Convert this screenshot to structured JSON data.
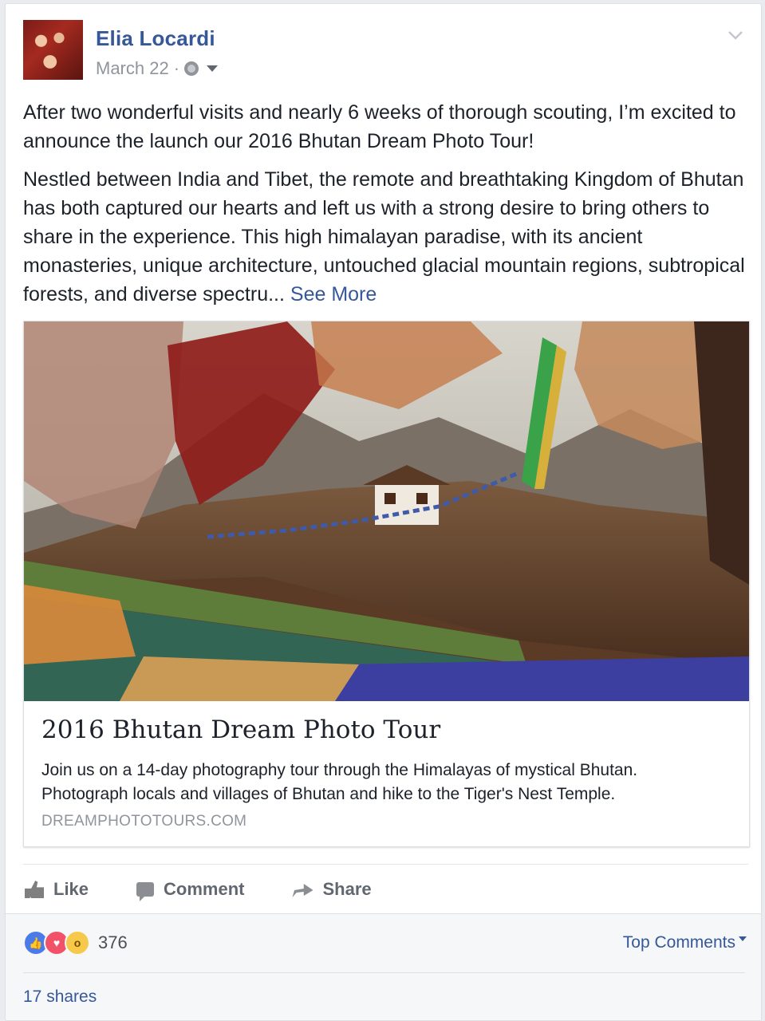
{
  "post": {
    "author": "Elia Locardi",
    "date": "March 22",
    "date_separator": "·",
    "paragraph1": "After two wonderful visits and nearly 6 weeks of thorough scouting, I’m excited to announce the launch our 2016 Bhutan Dream Photo Tour!",
    "paragraph2": "Nestled between India and Tibet, the remote and breathtaking Kingdom of Bhutan has both captured our hearts and left us with a strong desire to bring others to share in the experience. This high himalayan paradise, with its ancient monasteries, unique architecture, untouched glacial mountain regions, subtropical forests, and diverse spectru...",
    "see_more": "See More"
  },
  "link": {
    "title": "2016 Bhutan Dream Photo Tour",
    "description": "Join us on a 14-day photography tour through the Himalayas of mystical Bhutan. Photograph locals and villages of Bhutan and hike to the Tiger's Nest Temple.",
    "domain": "DREAMPHOTOTOURS.COM"
  },
  "actions": {
    "like": "Like",
    "comment": "Comment",
    "share": "Share"
  },
  "stats": {
    "reaction_count": "376",
    "top_comments": "Top Comments",
    "shares": "17 shares"
  },
  "colors": {
    "link_blue": "#365899",
    "muted_gray": "#90949c",
    "like_blue": "#4a7be8",
    "love_red": "#f25268",
    "wow_yellow": "#f7c94a"
  },
  "icons": [
    "globe-icon",
    "audience-caret-icon",
    "post-menu-chevron-icon",
    "like-icon",
    "comment-icon",
    "share-icon",
    "like-reaction-icon",
    "love-reaction-icon",
    "wow-reaction-icon"
  ]
}
